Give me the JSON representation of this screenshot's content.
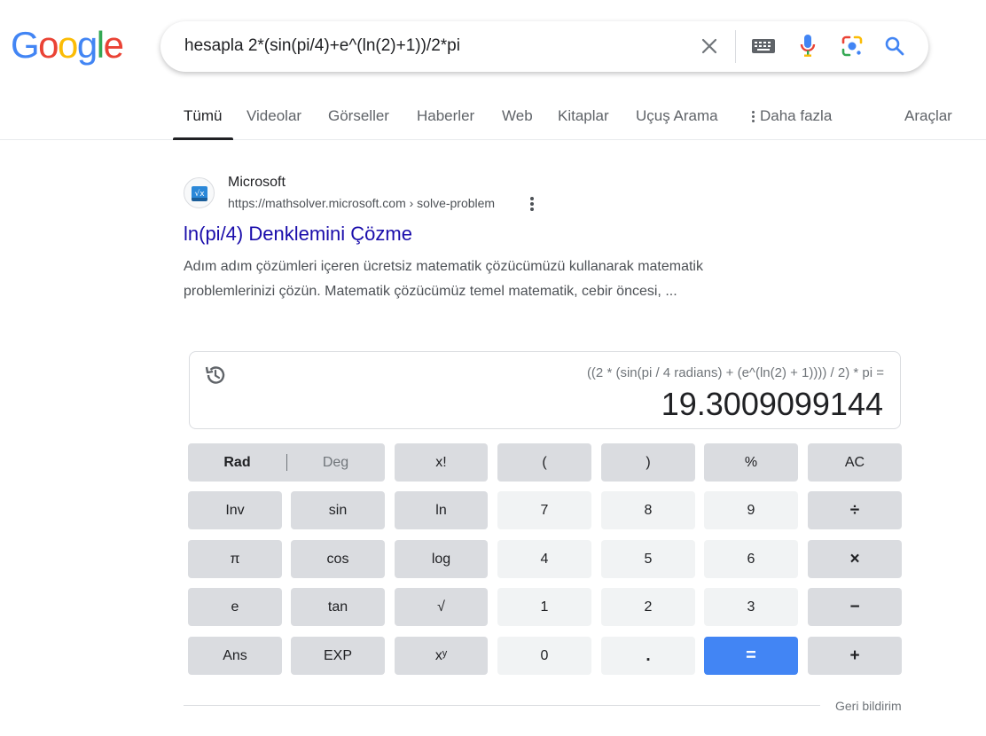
{
  "logo": {
    "letters": [
      {
        "char": "G",
        "color": "#4285f4"
      },
      {
        "char": "o",
        "color": "#ea4335"
      },
      {
        "char": "o",
        "color": "#fbbc05"
      },
      {
        "char": "g",
        "color": "#4285f4"
      },
      {
        "char": "l",
        "color": "#34a853"
      },
      {
        "char": "e",
        "color": "#ea4335"
      }
    ]
  },
  "search": {
    "query": "hesapla 2*(sin(pi/4)+e^(ln(2)+1))/2*pi",
    "icons": [
      "clear-icon",
      "keyboard-icon",
      "microphone-icon",
      "lens-icon",
      "search-icon"
    ]
  },
  "tabs": {
    "items": [
      {
        "label": "Tümü",
        "active": true
      },
      {
        "label": "Videolar"
      },
      {
        "label": "Görseller"
      },
      {
        "label": "Haberler"
      },
      {
        "label": "Web"
      },
      {
        "label": "Kitaplar"
      },
      {
        "label": "Uçuş Arama"
      },
      {
        "label": "Daha fazla"
      }
    ],
    "tools": "Araçlar"
  },
  "result": {
    "site_name": "Microsoft",
    "url": "https://mathsolver.microsoft.com › solve-problem",
    "title": "ln(pi/4) Denklemini Çözme",
    "snippet_line1": "Adım adım çözümleri içeren ücretsiz matematik çözücümüzü kullanarak matematik",
    "snippet_line2": "problemlerinizi çözün. Matematik çözücümüz temel matematik, cebir öncesi, ..."
  },
  "calculator": {
    "expression": "((2 * (sin(pi / 4 radians) + (e^(ln(2) + 1)))) / 2) * pi =",
    "result": "19.3009099144",
    "mode": {
      "rad": "Rad",
      "deg": "Deg",
      "selected": "Rad"
    },
    "keys": {
      "fact": "x!",
      "lparen": "(",
      "rparen": ")",
      "percent": "%",
      "ac": "AC",
      "inv": "Inv",
      "sin": "sin",
      "ln": "ln",
      "k7": "7",
      "k8": "8",
      "k9": "9",
      "div": "÷",
      "pi": "π",
      "cos": "cos",
      "log": "log",
      "k4": "4",
      "k5": "5",
      "k6": "6",
      "mul": "×",
      "e": "e",
      "tan": "tan",
      "sqrt": "√",
      "k1": "1",
      "k2": "2",
      "k3": "3",
      "minus": "−",
      "ans": "Ans",
      "exp": "EXP",
      "pow": "xʸ",
      "k0": "0",
      "dot": ".",
      "eq": "=",
      "plus": "+"
    },
    "feedback": "Geri bildirim",
    "colors": {
      "equals": "#4285f4",
      "fn_key": "#dadce0",
      "num_key": "#f1f3f4"
    }
  },
  "colors": {
    "link": "#1a0dab",
    "text": "#202124",
    "muted": "#4d5156"
  }
}
